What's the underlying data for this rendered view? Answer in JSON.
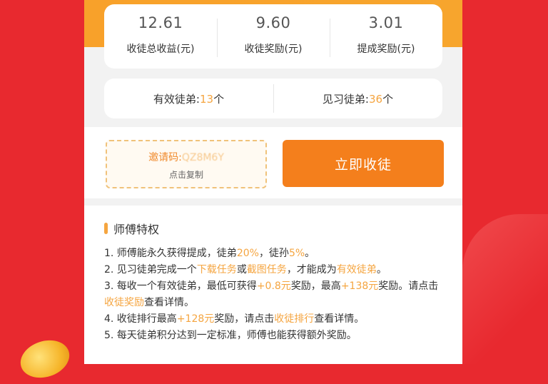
{
  "stats": [
    {
      "value": "12.61",
      "label": "收徒总收益(元)"
    },
    {
      "value": "9.60",
      "label": "收徒奖励(元)"
    },
    {
      "value": "3.01",
      "label": "提成奖励(元)"
    }
  ],
  "disciples": {
    "valid_label": "有效徒弟:",
    "valid_count": "13",
    "valid_unit": "个",
    "trainee_label": "见习徒弟:",
    "trainee_count": "36",
    "trainee_unit": "个"
  },
  "invite": {
    "label": "邀请码:",
    "code": "QZ8M6Y",
    "copy_hint": "点击复制",
    "recruit_button": "立即收徒"
  },
  "privileges": {
    "title": "师傅特权",
    "items": [
      [
        {
          "t": "1. 师傅能永久获得提成，徒弟"
        },
        {
          "t": "20%",
          "hl": true
        },
        {
          "t": "，徒孙"
        },
        {
          "t": "5%",
          "hl": true
        },
        {
          "t": "。"
        }
      ],
      [
        {
          "t": "2. 见习徒弟完成一个"
        },
        {
          "t": "下载任务",
          "hl": true
        },
        {
          "t": "或"
        },
        {
          "t": "截图任务",
          "hl": true
        },
        {
          "t": "，才能成为"
        },
        {
          "t": "有效徒弟",
          "hl": true
        },
        {
          "t": "。"
        }
      ],
      [
        {
          "t": "3. 每收一个有效徒弟，最低可获得"
        },
        {
          "t": "+0.8元",
          "hl": true
        },
        {
          "t": "奖励，最高"
        },
        {
          "t": "+138元",
          "hl": true
        },
        {
          "t": "奖励。请点击"
        },
        {
          "t": "收徒奖励",
          "hl": true
        },
        {
          "t": "查看详情。"
        }
      ],
      [
        {
          "t": "4. 收徒排行最高"
        },
        {
          "t": "+128元",
          "hl": true
        },
        {
          "t": "奖励，请点击"
        },
        {
          "t": "收徒排行",
          "hl": true
        },
        {
          "t": "查看详情。"
        }
      ],
      [
        {
          "t": "5. 每天徒弟积分达到一定标准，师傅也能获得额外奖励。"
        }
      ]
    ]
  },
  "colors": {
    "background_red": "#e8292f",
    "accent_orange": "#f47f1c",
    "highlight": "#f5a540"
  }
}
